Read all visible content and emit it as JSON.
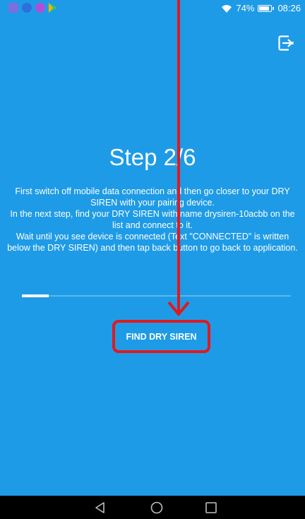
{
  "status_bar": {
    "battery": "74%",
    "time": "08:26",
    "notification_icons": [
      "gallery-icon",
      "shield-icon",
      "app-icon",
      "play-store-icon"
    ]
  },
  "main": {
    "step_title": "Step 2/6",
    "instructions": [
      "First switch off mobile data connection and then go closer to your DRY SIREN with your pairing device.",
      "In the next step, find your DRY SIREN with name drysiren-10acbb on the list and connect to it.",
      "Wait until you see device is connected (Text \"CONNECTED\" is written below the DRY SIREN) and then tap back button to go back to application."
    ],
    "progress_fraction": 0.1,
    "find_button_label": "FIND DRY SIREN"
  },
  "colors": {
    "background": "#1e9be6",
    "annotation": "#e0191f",
    "text": "#ffffff"
  },
  "nav_bar": {
    "icons": [
      "back-icon",
      "home-icon",
      "recents-icon"
    ]
  }
}
